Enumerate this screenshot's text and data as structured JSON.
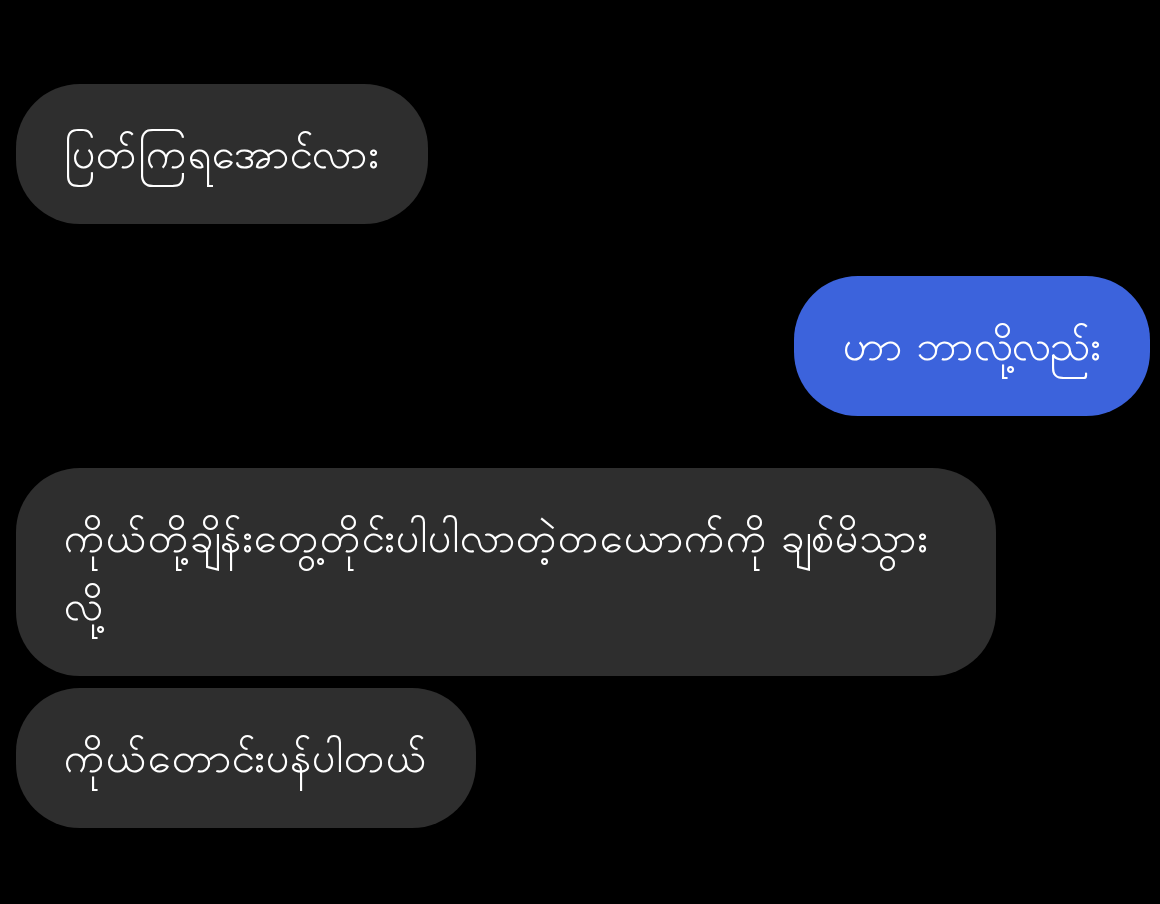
{
  "messages": [
    {
      "text": "ပြတ်ကြရအောင်လား",
      "outgoing": false
    },
    {
      "text": "ဟာ ဘာလို့လည်း",
      "outgoing": true
    },
    {
      "text": "ကိုယ်တို့ချိန်းတွေ့တိုင်းပါပါလာတဲ့တယောက်ကို ချစ်မိသွားလို့",
      "outgoing": false
    },
    {
      "text": "ကိုယ်တောင်းပန်ပါတယ်",
      "outgoing": false
    }
  ]
}
